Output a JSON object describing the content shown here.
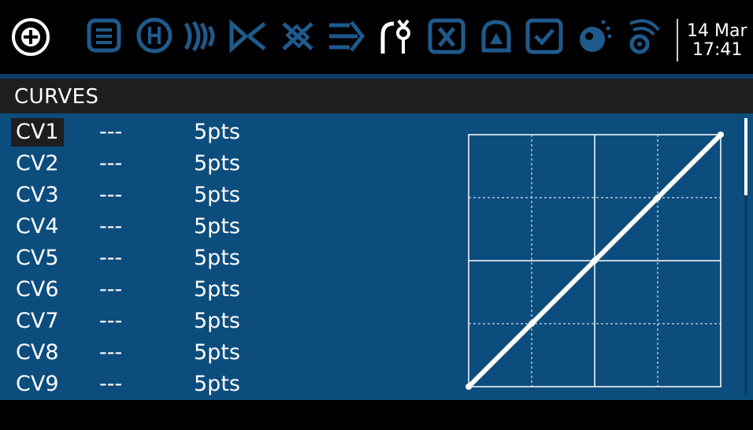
{
  "statusbar": {
    "icons": [
      "radio-menu-icon",
      "model-setup-icon",
      "heli-icon",
      "flight-modes-icon",
      "inputs-icon",
      "mixer-icon",
      "outputs-icon",
      "curves-icon",
      "global-variables-icon",
      "logical-switches-icon",
      "special-functions-icon",
      "checklist-icon",
      "telemetry-icon",
      "sound-icon"
    ],
    "date": "14 Mar",
    "time": "17:41"
  },
  "page": {
    "title": "CURVES"
  },
  "curves": [
    {
      "name": "CV1",
      "label": "---",
      "points": "5pts",
      "selected": true
    },
    {
      "name": "CV2",
      "label": "---",
      "points": "5pts"
    },
    {
      "name": "CV3",
      "label": "---",
      "points": "5pts"
    },
    {
      "name": "CV4",
      "label": "---",
      "points": "5pts"
    },
    {
      "name": "CV5",
      "label": "---",
      "points": "5pts"
    },
    {
      "name": "CV6",
      "label": "---",
      "points": "5pts"
    },
    {
      "name": "CV7",
      "label": "---",
      "points": "5pts"
    },
    {
      "name": "CV8",
      "label": "---",
      "points": "5pts"
    },
    {
      "name": "CV9",
      "label": "---",
      "points": "5pts"
    }
  ],
  "preview": {
    "curve": "CV1",
    "x": [
      -100,
      -50,
      0,
      50,
      100
    ],
    "y": [
      -100,
      -50,
      0,
      50,
      100
    ]
  },
  "colors": {
    "background": "#0d4d7e",
    "header": "#1e1e1e",
    "accent": "#1f5a8c",
    "foreground": "#ffffff"
  }
}
